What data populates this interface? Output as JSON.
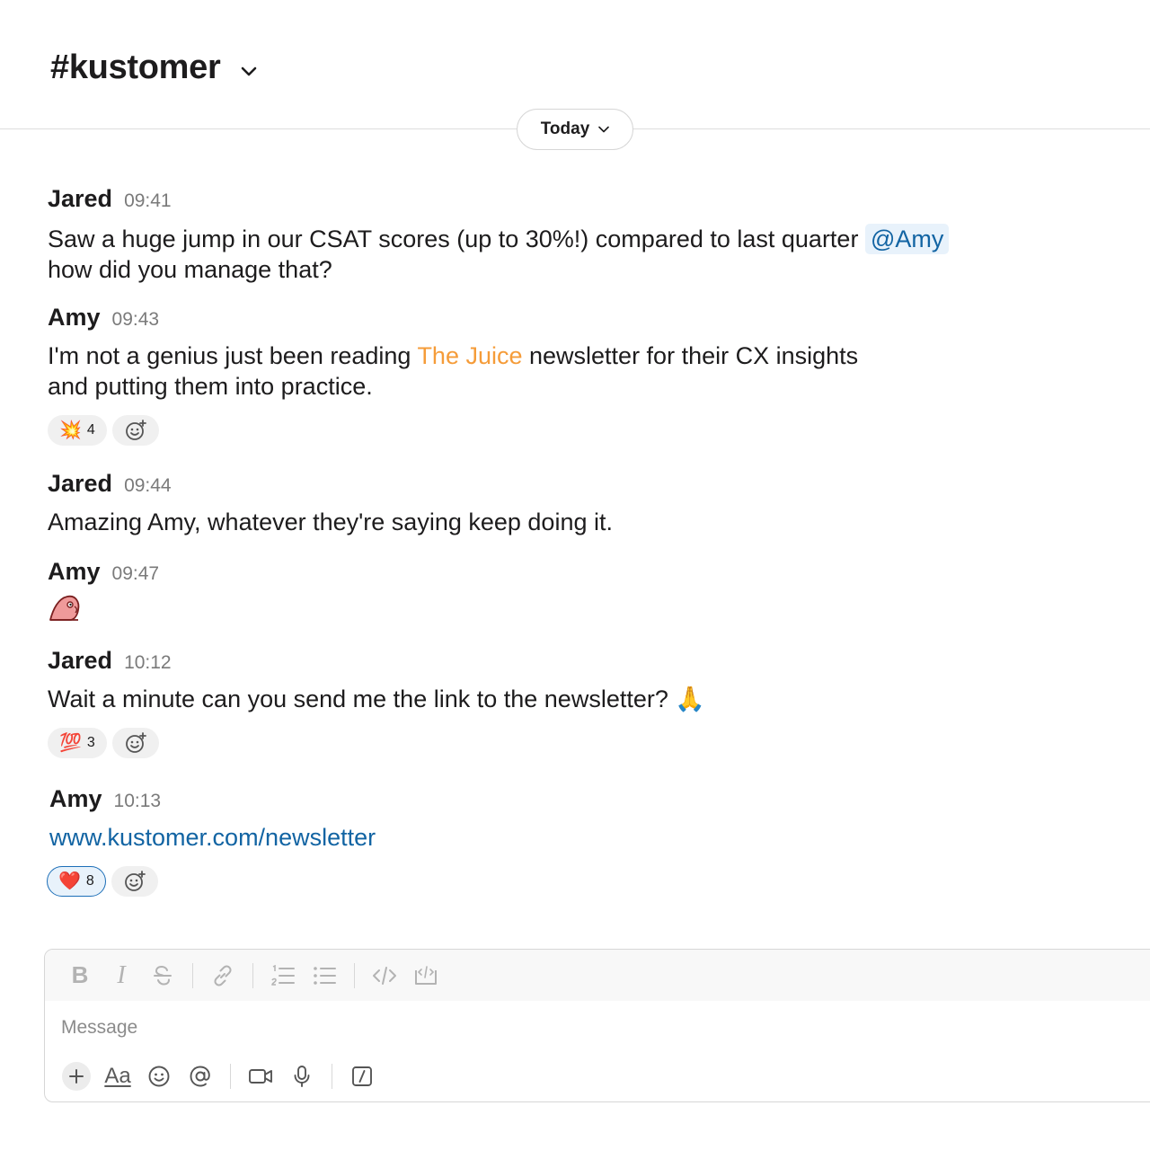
{
  "channel": {
    "name": "#kustomer"
  },
  "date_divider": {
    "label": "Today"
  },
  "messages": [
    {
      "author": "Jared",
      "time": "09:41",
      "text_before": "Saw a huge jump in our CSAT scores (up to 30%!) compared to last quarter ",
      "mention": "@Amy",
      "text_after": "how did you manage that?"
    },
    {
      "author": "Amy",
      "time": "09:43",
      "text_before": "I'm not a genius just been reading ",
      "highlight": "The Juice",
      "text_after": " newsletter for their CX insights",
      "text_line2": "and putting them into practice.",
      "reaction": {
        "emoji": "💥",
        "count": "4"
      }
    },
    {
      "author": "Jared",
      "time": "09:44",
      "text": "Amazing Amy, whatever they're saying keep doing it."
    },
    {
      "author": "Amy",
      "time": "09:47",
      "emoji": "parrot"
    },
    {
      "author": "Jared",
      "time": "10:12",
      "text": "Wait a minute can you send me the link to the newsletter? ",
      "emoji": "🙏",
      "reaction": {
        "emoji": "💯",
        "count": "3"
      }
    },
    {
      "author": "Amy",
      "time": "10:13",
      "link": "www.kustomer.com/newsletter",
      "reaction": {
        "emoji": "❤️",
        "count": "8"
      }
    }
  ],
  "composer": {
    "placeholder": "Message",
    "format_label": "Aa"
  }
}
